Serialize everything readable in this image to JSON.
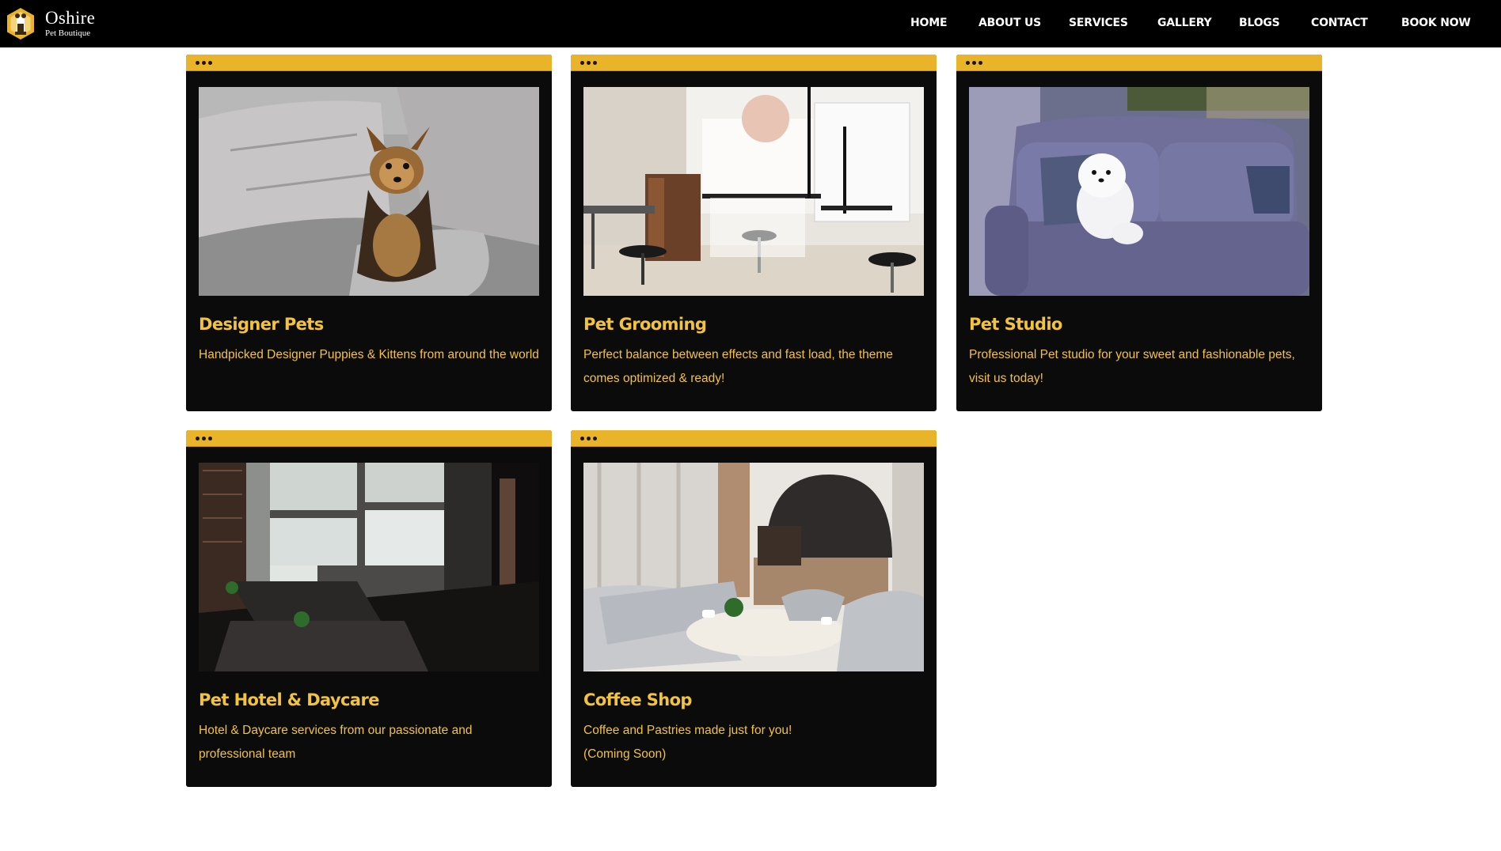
{
  "brand": {
    "name": "Oshire",
    "tagline": "Pet Boutique"
  },
  "nav": {
    "items": [
      {
        "label": "HOME"
      },
      {
        "label": "ABOUT US"
      },
      {
        "label": "SERVICES"
      },
      {
        "label": "GALLERY"
      },
      {
        "label": "BLOGS"
      },
      {
        "label": "CONTACT"
      },
      {
        "label": "BOOK NOW"
      }
    ]
  },
  "colors": {
    "header_bg": "#000000",
    "card_bg": "#0c0b0b",
    "accent": "#e9b32a",
    "text_accent": "#f2c33d"
  },
  "cards": [
    {
      "title": "Designer Pets",
      "description": "Handpicked Designer Puppies & Kittens from around the world",
      "image": "puppy-on-grey-sofa"
    },
    {
      "title": "Pet Grooming",
      "description": "Perfect balance between effects and fast load, the theme comes optimized & ready!",
      "image": "grooming-room"
    },
    {
      "title": "Pet Studio",
      "description": "Professional Pet studio for your sweet and fashionable pets, visit us today!",
      "image": "pomeranian-on-blue-sofa"
    },
    {
      "title": "Pet Hotel & Daycare",
      "description": "Hotel & Daycare services from our passionate and professional team",
      "image": "hotel-lounge"
    },
    {
      "title": "Coffee Shop",
      "description": "Coffee and Pastries made just for you!",
      "description2": "(Coming Soon)",
      "image": "coffee-shop-interior"
    }
  ]
}
